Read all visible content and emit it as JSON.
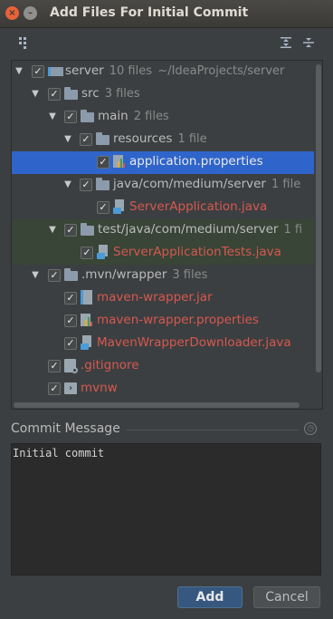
{
  "window": {
    "title": "Add Files For Initial Commit",
    "close_glyph": "×",
    "minimize_glyph": "–"
  },
  "toolbar": {
    "group_icon": "group-by-icon",
    "expand_icon": "expand-all-icon",
    "collapse_icon": "collapse-all-icon"
  },
  "tree": {
    "rows": [
      {
        "name": "server",
        "count": "10 files",
        "path": "~/IdeaProjects/server",
        "kind": "module",
        "color": "norm"
      },
      {
        "name": "src",
        "count": "3 files",
        "kind": "folder",
        "color": "norm"
      },
      {
        "name": "main",
        "count": "2 files",
        "kind": "folder",
        "color": "norm"
      },
      {
        "name": "resources",
        "count": "1 file",
        "kind": "folder",
        "color": "norm"
      },
      {
        "name": "application.properties",
        "kind": "properties",
        "color": "white",
        "selected": true
      },
      {
        "name": "java/com/medium/server",
        "count": "1 file",
        "kind": "folder",
        "color": "norm"
      },
      {
        "name": "ServerApplication.java",
        "kind": "java",
        "color": "red"
      },
      {
        "name": "test/java/com/medium/server",
        "count": "1 fi",
        "kind": "folder",
        "color": "norm"
      },
      {
        "name": "ServerApplicationTests.java",
        "kind": "java",
        "color": "red"
      },
      {
        "name": ".mvn/wrapper",
        "count": "3 files",
        "kind": "folder",
        "color": "norm"
      },
      {
        "name": "maven-wrapper.jar",
        "kind": "jar",
        "color": "red"
      },
      {
        "name": "maven-wrapper.properties",
        "kind": "properties",
        "color": "red"
      },
      {
        "name": "MavenWrapperDownloader.java",
        "kind": "java",
        "color": "red"
      },
      {
        "name": ".gitignore",
        "kind": "git",
        "color": "red"
      },
      {
        "name": "mvnw",
        "kind": "shell",
        "color": "red"
      }
    ],
    "check_glyph": "✓",
    "expanded_glyph": "▼"
  },
  "commit": {
    "label": "Commit Message",
    "history_icon": "history-icon",
    "message": "Initial commit"
  },
  "buttons": {
    "add": "Add",
    "cancel": "Cancel"
  },
  "colors": {
    "background": "#3c3f41",
    "selection": "#2f65ca",
    "unversioned": "#d6584f",
    "modified_row": "#384537",
    "primary_button": "#365880"
  }
}
